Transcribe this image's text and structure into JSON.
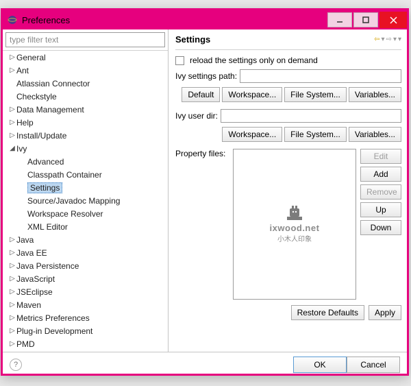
{
  "window": {
    "title": "Preferences"
  },
  "filter_placeholder": "type filter text",
  "tree": {
    "items": [
      {
        "label": "General",
        "expand": "▷"
      },
      {
        "label": "Ant",
        "expand": "▷"
      },
      {
        "label": "Atlassian Connector",
        "expand": ""
      },
      {
        "label": "Checkstyle",
        "expand": ""
      },
      {
        "label": "Data Management",
        "expand": "▷"
      },
      {
        "label": "Help",
        "expand": "▷"
      },
      {
        "label": "Install/Update",
        "expand": "▷"
      },
      {
        "label": "Ivy",
        "expand": "◢",
        "children": [
          {
            "label": "Advanced"
          },
          {
            "label": "Classpath Container"
          },
          {
            "label": "Settings",
            "selected": true
          },
          {
            "label": "Source/Javadoc Mapping"
          },
          {
            "label": "Workspace Resolver"
          },
          {
            "label": "XML Editor"
          }
        ]
      },
      {
        "label": "Java",
        "expand": "▷"
      },
      {
        "label": "Java EE",
        "expand": "▷"
      },
      {
        "label": "Java Persistence",
        "expand": "▷"
      },
      {
        "label": "JavaScript",
        "expand": "▷"
      },
      {
        "label": "JSEclipse",
        "expand": "▷"
      },
      {
        "label": "Maven",
        "expand": "▷"
      },
      {
        "label": "Metrics Preferences",
        "expand": "▷"
      },
      {
        "label": "Plug-in Development",
        "expand": "▷"
      },
      {
        "label": "PMD",
        "expand": "▷"
      }
    ]
  },
  "page": {
    "heading": "Settings",
    "reload_label": "reload the settings only on demand",
    "settings_path_label": "Ivy settings path:",
    "settings_path_value": "",
    "user_dir_label": "Ivy user dir:",
    "user_dir_value": "",
    "btn_default": "Default",
    "btn_workspace": "Workspace...",
    "btn_filesystem": "File System...",
    "btn_variables": "Variables...",
    "property_files_label": "Property files:",
    "btn_edit": "Edit",
    "btn_add": "Add",
    "btn_remove": "Remove",
    "btn_up": "Up",
    "btn_down": "Down",
    "btn_restore": "Restore Defaults",
    "btn_apply": "Apply"
  },
  "footer": {
    "btn_ok": "OK",
    "btn_cancel": "Cancel"
  },
  "watermark": {
    "logo": "ixwood.net",
    "sub": "小木人印象"
  }
}
